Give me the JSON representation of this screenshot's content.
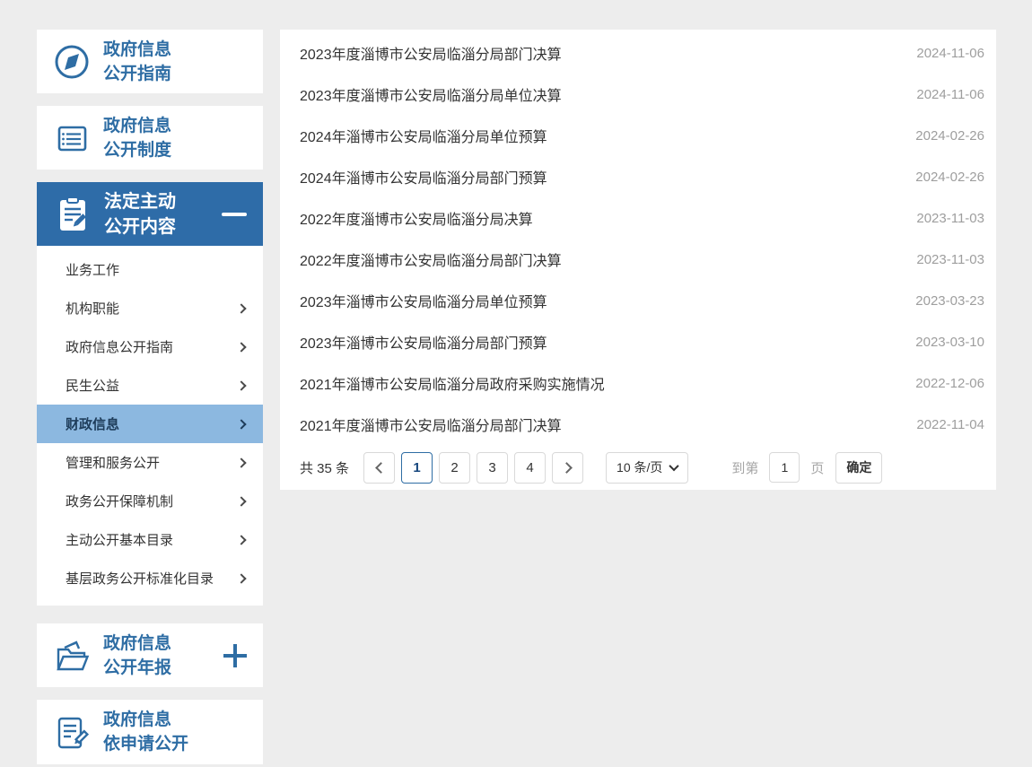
{
  "colors": {
    "accent": "#2e6da4",
    "statutory_header_bg": "#2e6ca8",
    "active_item_bg": "#8cb8e0",
    "date_text": "#9e9e9e",
    "page_bg": "#ededed"
  },
  "icons": {
    "guide": "compass-icon",
    "system": "book-icon",
    "statutory": "clipboard-pencil-icon",
    "statutory_state": "minus-icon",
    "annual": "folder-documents-icon",
    "annual_state": "plus-icon",
    "apply": "document-pencil-icon",
    "submenu_arrow": "chevron-right-icon"
  },
  "sidebar": {
    "guide": {
      "line1": "政府信息",
      "line2": "公开指南"
    },
    "system": {
      "line1": "政府信息",
      "line2": "公开制度"
    },
    "statutory": {
      "line1": "法定主动",
      "line2": "公开内容"
    },
    "submenu": [
      {
        "label": "业务工作",
        "has_arrow": false,
        "active": false
      },
      {
        "label": "机构职能",
        "has_arrow": true,
        "active": false
      },
      {
        "label": "政府信息公开指南",
        "has_arrow": true,
        "active": false
      },
      {
        "label": "民生公益",
        "has_arrow": true,
        "active": false
      },
      {
        "label": "财政信息",
        "has_arrow": true,
        "active": true
      },
      {
        "label": "管理和服务公开",
        "has_arrow": true,
        "active": false
      },
      {
        "label": "政务公开保障机制",
        "has_arrow": true,
        "active": false
      },
      {
        "label": "主动公开基本目录",
        "has_arrow": true,
        "active": false
      },
      {
        "label": "基层政务公开标准化目录",
        "has_arrow": true,
        "active": false
      }
    ],
    "annual": {
      "line1": "政府信息",
      "line2": "公开年报"
    },
    "apply": {
      "line1": "政府信息",
      "line2": "依申请公开"
    }
  },
  "list": {
    "items": [
      {
        "title": "2023年度淄博市公安局临淄分局部门决算",
        "date": "2024-11-06"
      },
      {
        "title": "2023年度淄博市公安局临淄分局单位决算",
        "date": "2024-11-06"
      },
      {
        "title": "2024年淄博市公安局临淄分局单位预算",
        "date": "2024-02-26"
      },
      {
        "title": "2024年淄博市公安局临淄分局部门预算",
        "date": "2024-02-26"
      },
      {
        "title": "2022年度淄博市公安局临淄分局决算",
        "date": "2023-11-03"
      },
      {
        "title": "2022年度淄博市公安局临淄分局部门决算",
        "date": "2023-11-03"
      },
      {
        "title": "2023年淄博市公安局临淄分局单位预算",
        "date": "2023-03-23"
      },
      {
        "title": "2023年淄博市公安局临淄分局部门预算",
        "date": "2023-03-10"
      },
      {
        "title": "2021年淄博市公安局临淄分局政府采购实施情况",
        "date": "2022-12-06"
      },
      {
        "title": "2021年度淄博市公安局临淄分局部门决算",
        "date": "2022-11-04"
      }
    ]
  },
  "pagination": {
    "total_label": "共 35 条",
    "pages": [
      {
        "num": "1",
        "active": true
      },
      {
        "num": "2",
        "active": false
      },
      {
        "num": "3",
        "active": false
      },
      {
        "num": "4",
        "active": false
      }
    ],
    "page_size": "10 条/页",
    "goto_prefix": "到第",
    "goto_value": "1",
    "goto_suffix": "页",
    "confirm": "确定"
  }
}
